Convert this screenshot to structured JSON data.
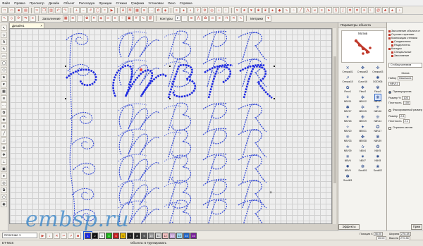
{
  "menu": [
    "Файл",
    "Правка",
    "Просмотр",
    "Дизайн",
    "Объект",
    "Раскладка",
    "Функции",
    "Стежки",
    "Графика",
    "Установки",
    "Окно",
    "Справка"
  ],
  "toolbar": {
    "stitch_mode_label": "Заполнение",
    "contours_label": "Контуры",
    "metrics_label": "Метрики"
  },
  "document_tab": "Дизайн1",
  "objects_panel": {
    "title": "Параметры объекта",
    "preview_caption": "Мотив",
    "stitches": [
      "Стежок01",
      "Стежок02",
      "Стежок03",
      "Стежок10",
      "Curve16",
      "DOD006",
      "Fleur1",
      "Fleur2",
      "Fleur3",
      "NBV11",
      "NBV12",
      "NBV13",
      "NBV17",
      "NBV15",
      "NBV16",
      "NBV18",
      "NBV19",
      "NBV14",
      "NBV20",
      "NBV21",
      "NBV17",
      "NBV33",
      "NBV38",
      "NBV39",
      "NBV39",
      "NBV4",
      "NBV5",
      "NBV6",
      "NBV7",
      "NBV8",
      "NBV9",
      "Scroll01",
      "Scroll02",
      "Scroll03"
    ],
    "selected_index": 11
  },
  "props_panel": {
    "tree": [
      "Заполнение объекта ст",
      "Строчка страними",
      "Композиция степями",
      "Соединители",
      "Разделитель",
      "Контуры",
      "Специальные",
      "Заполнение"
    ],
    "stitch_name_field": "Стобац мотивом",
    "motif_label": "Мотив",
    "set_label": "Набор",
    "set_value": "Blackwork",
    "motif_value": "NBV11",
    "primary_label": "Преимущества",
    "size_label": "Размер %",
    "size_value": "100",
    "density_label": "Плотность",
    "density_value": "100",
    "fixed_size_label": "Фиксированный размер",
    "size2_label": "Размер",
    "size2_value": "2.8",
    "density2_label": "Плотность",
    "density2_value": "2.1",
    "reflect_label": "Отразить мотив"
  },
  "bottom": {
    "layer": "Сплетние 1",
    "colors": [
      "#1f2be0",
      "#111111",
      "#f2f2f2",
      "#1fb31a",
      "#c81e1e",
      "#e6b800",
      "#1a1a1a",
      "#202020",
      "#5a5a5a",
      "#9a9a9a",
      "#d6d6d6",
      "#f5c2c2",
      "#c8a8d8",
      "#9fd9f0",
      "#2166c9",
      "#7a1f9a"
    ],
    "swatch_labels": [
      "1",
      "2",
      "3",
      "4",
      "5",
      "6",
      "7",
      "8",
      "9",
      "10",
      "11",
      "12",
      "13",
      "14",
      "15",
      "16"
    ],
    "selected_color": 0,
    "object_count": "Объекта: 5 Группировать",
    "pos_label": "Позиция X",
    "pos_x": "46.00",
    "pos_y": "30.00",
    "width_label": "Ширина",
    "width_value": "278.38",
    "height_label": "Высота",
    "height_value": "270.38",
    "effects_btn": "Эффекты",
    "apply_btn": "Прим"
  },
  "status": "ET-NGS",
  "watermark": "embsp.ru"
}
